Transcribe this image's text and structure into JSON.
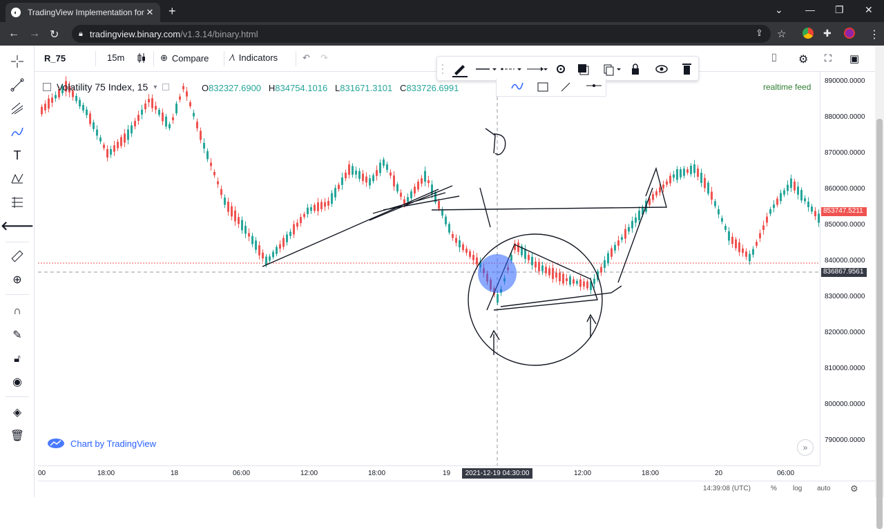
{
  "browser": {
    "tab_title": "TradingView Implementation for",
    "url_host": "tradingview.binary.com",
    "url_path": "/v1.3.14/binary.html"
  },
  "toolbar": {
    "symbol": "R_75",
    "interval": "15m",
    "compare_label": "Compare",
    "indicators_label": "Indicators"
  },
  "legend": {
    "title": "Volatility 75 Index, 15",
    "open_label": "O",
    "open": "832327.6900",
    "high_label": "H",
    "high": "834754.1016",
    "low_label": "L",
    "low": "831671.3101",
    "close_label": "C",
    "close": "833726.6991",
    "feed": "realtime feed"
  },
  "price_scale": {
    "ticks": [
      "890000.0000",
      "880000.0000",
      "870000.0000",
      "860000.0000",
      "850000.0000",
      "840000.0000",
      "830000.0000",
      "820000.0000",
      "810000.0000",
      "800000.0000",
      "790000.0000"
    ],
    "last_price": "853747.5211",
    "crosshair_price": "836867.9561"
  },
  "time_scale": {
    "ticks": [
      "00",
      "18:00",
      "18",
      "06:00",
      "12:00",
      "18:00",
      "19",
      "12:00",
      "18:00",
      "20",
      "06:00"
    ],
    "crosshair_time": "2021-12-19 04:30:00"
  },
  "bottom_bar": {
    "clock": "14:39:08 (UTC)",
    "percent": "%",
    "log": "log",
    "auto": "auto"
  },
  "watermark": "Chart by TradingView",
  "colors": {
    "up": "#26a69a",
    "down": "#ef5350",
    "accent": "#2962ff"
  }
}
